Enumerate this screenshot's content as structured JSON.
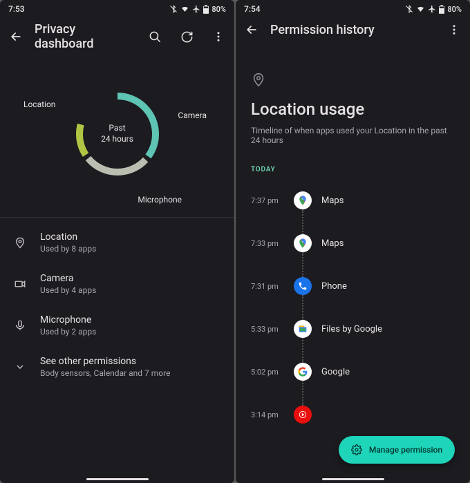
{
  "left": {
    "status": {
      "time": "7:53",
      "battery": "80%"
    },
    "appbar": {
      "title": "Privacy dashboard"
    },
    "chart": {
      "center_line1": "Past",
      "center_line2": "24 hours",
      "labels": {
        "location": "Location",
        "camera": "Camera",
        "microphone": "Microphone"
      }
    },
    "perms": [
      {
        "icon": "location",
        "title": "Location",
        "subtitle": "Used by 8 apps"
      },
      {
        "icon": "camera",
        "title": "Camera",
        "subtitle": "Used by 4 apps"
      },
      {
        "icon": "microphone",
        "title": "Microphone",
        "subtitle": "Used by 2 apps"
      },
      {
        "icon": "expand",
        "title": "See other permissions",
        "subtitle": "Body sensors, Calendar and 7 more"
      }
    ]
  },
  "right": {
    "status": {
      "time": "7:54",
      "battery": "80%"
    },
    "appbar": {
      "title": "Permission history"
    },
    "header": {
      "title": "Location usage",
      "subtitle": "Timeline of when apps used your Location in the past 24 hours"
    },
    "today_label": "TODAY",
    "timeline": [
      {
        "time": "7:37 pm",
        "app": "Maps",
        "icon": "maps"
      },
      {
        "time": "7:33 pm",
        "app": "Maps",
        "icon": "maps"
      },
      {
        "time": "7:31 pm",
        "app": "Phone",
        "icon": "phone"
      },
      {
        "time": "5:33 pm",
        "app": "Files by Google",
        "icon": "files"
      },
      {
        "time": "5:02 pm",
        "app": "Google",
        "icon": "google"
      },
      {
        "time": "3:14 pm",
        "app": "",
        "icon": "ytmusic"
      }
    ],
    "fab": {
      "label": "Manage permission"
    }
  },
  "chart_data": {
    "type": "pie",
    "title": "Past 24 hours",
    "categories": [
      "Location",
      "Camera",
      "Microphone"
    ],
    "values": [
      8,
      4,
      2
    ],
    "colors": [
      "#5ec4b4",
      "#b9beb0",
      "#b2c444"
    ]
  }
}
